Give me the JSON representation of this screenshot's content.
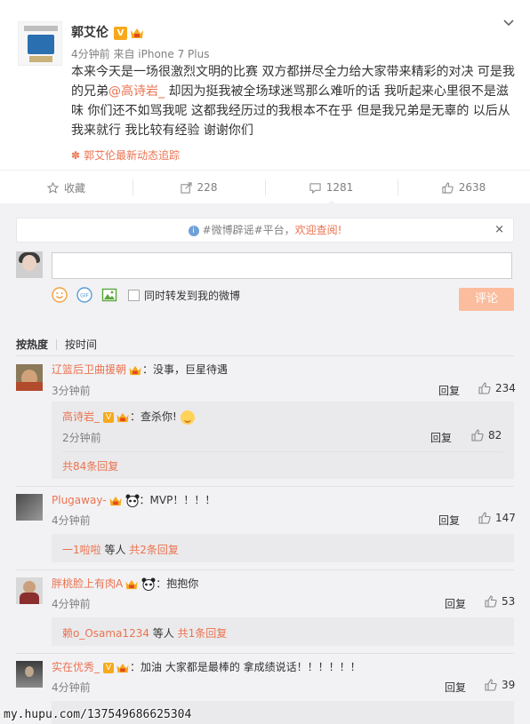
{
  "post": {
    "author": "郭艾伦",
    "meta": "4分钟前 来自 iPhone 7 Plus",
    "body_parts": {
      "before": "本来今天是一场很激烈文明的比赛 双方都拼尽全力给大家带来精彩的对决 可是我的兄弟",
      "mention": "@高诗岩_",
      "after": " 却因为挺我被全场球迷骂那么难听的话 我听起来心里很不是滋味 你们还不如骂我呢 这都我经历过的我根本不在乎 但是我兄弟是无辜的 以后从我来就行 我比较有经验 谢谢你们"
    },
    "follow_link": "郭艾伦最新动态追踪"
  },
  "actions": {
    "favorite_label": "收藏",
    "repost_count": "228",
    "comment_count": "1281",
    "like_count": "2638"
  },
  "notice": {
    "text_prefix": "#微博辟谣#平台，",
    "text_link": "欢迎查阅!",
    "close": "×"
  },
  "composer": {
    "repost_label": "同时转发到我的微博",
    "submit_label": "评论"
  },
  "sort": {
    "by_hot": "按热度",
    "by_time": "按时间"
  },
  "comments": [
    {
      "name": "辽篮后卫曲援朝",
      "text": "：没事，巨星待遇",
      "time": "3分钟前",
      "reply": "回复",
      "likes": "234",
      "sub": {
        "name": "高诗岩_",
        "text": "：查杀你!",
        "time": "2分钟前",
        "reply": "回复",
        "likes": "82",
        "more": "共84条回复"
      }
    },
    {
      "name": "Plugaway-",
      "text": "：MVP！！！！",
      "time": "4分钟前",
      "reply": "回复",
      "likes": "147",
      "more_name": "一1啦啦",
      "more_mid": " 等人 ",
      "more_link": "共2条回复"
    },
    {
      "name": "胖桃脸上有肉A",
      "text": "：抱抱你",
      "time": "4分钟前",
      "reply": "回复",
      "likes": "53",
      "more_name": "赖o_Osama1234",
      "more_mid": " 等人 ",
      "more_link": "共1条回复"
    },
    {
      "name": "实在优秀_",
      "text": "：加油 大家都是最棒的 拿成绩说话！！！！！！",
      "time": "4分钟前",
      "reply": "回复",
      "likes": "39"
    }
  ],
  "watermark": "my.hupu.com/137549686625304",
  "colors": {
    "accent": "#eb7350",
    "submit_disabled": "#fbbd9e",
    "background": "#f2f2f5"
  }
}
